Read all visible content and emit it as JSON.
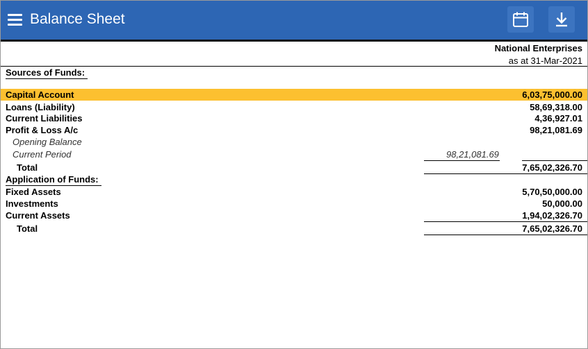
{
  "app": {
    "title": "Balance Sheet"
  },
  "header": {
    "company": "National Enterprises",
    "as_at": "as at 31-Mar-2021"
  },
  "sources": {
    "heading": "Sources of Funds:",
    "rows": [
      {
        "label": "Capital Account",
        "amount": "6,03,75,000.00"
      },
      {
        "label": "Loans (Liability)",
        "amount": "58,69,318.00"
      },
      {
        "label": "Current Liabilities",
        "amount": "4,36,927.01"
      },
      {
        "label": "Profit & Loss A/c",
        "amount": "98,21,081.69"
      }
    ],
    "pl_breakup": [
      {
        "label": "Opening Balance",
        "amount": ""
      },
      {
        "label": "Current Period",
        "amount": "98,21,081.69"
      }
    ],
    "total_label": "Total",
    "total": "7,65,02,326.70"
  },
  "application": {
    "heading": "Application of Funds:",
    "rows": [
      {
        "label": "Fixed Assets",
        "amount": "5,70,50,000.00"
      },
      {
        "label": "Investments",
        "amount": "50,000.00"
      },
      {
        "label": "Current Assets",
        "amount": "1,94,02,326.70"
      }
    ],
    "total_label": "Total",
    "total": "7,65,02,326.70"
  },
  "colors": {
    "topbar": "#2d66b4",
    "highlight": "#fcc030"
  }
}
